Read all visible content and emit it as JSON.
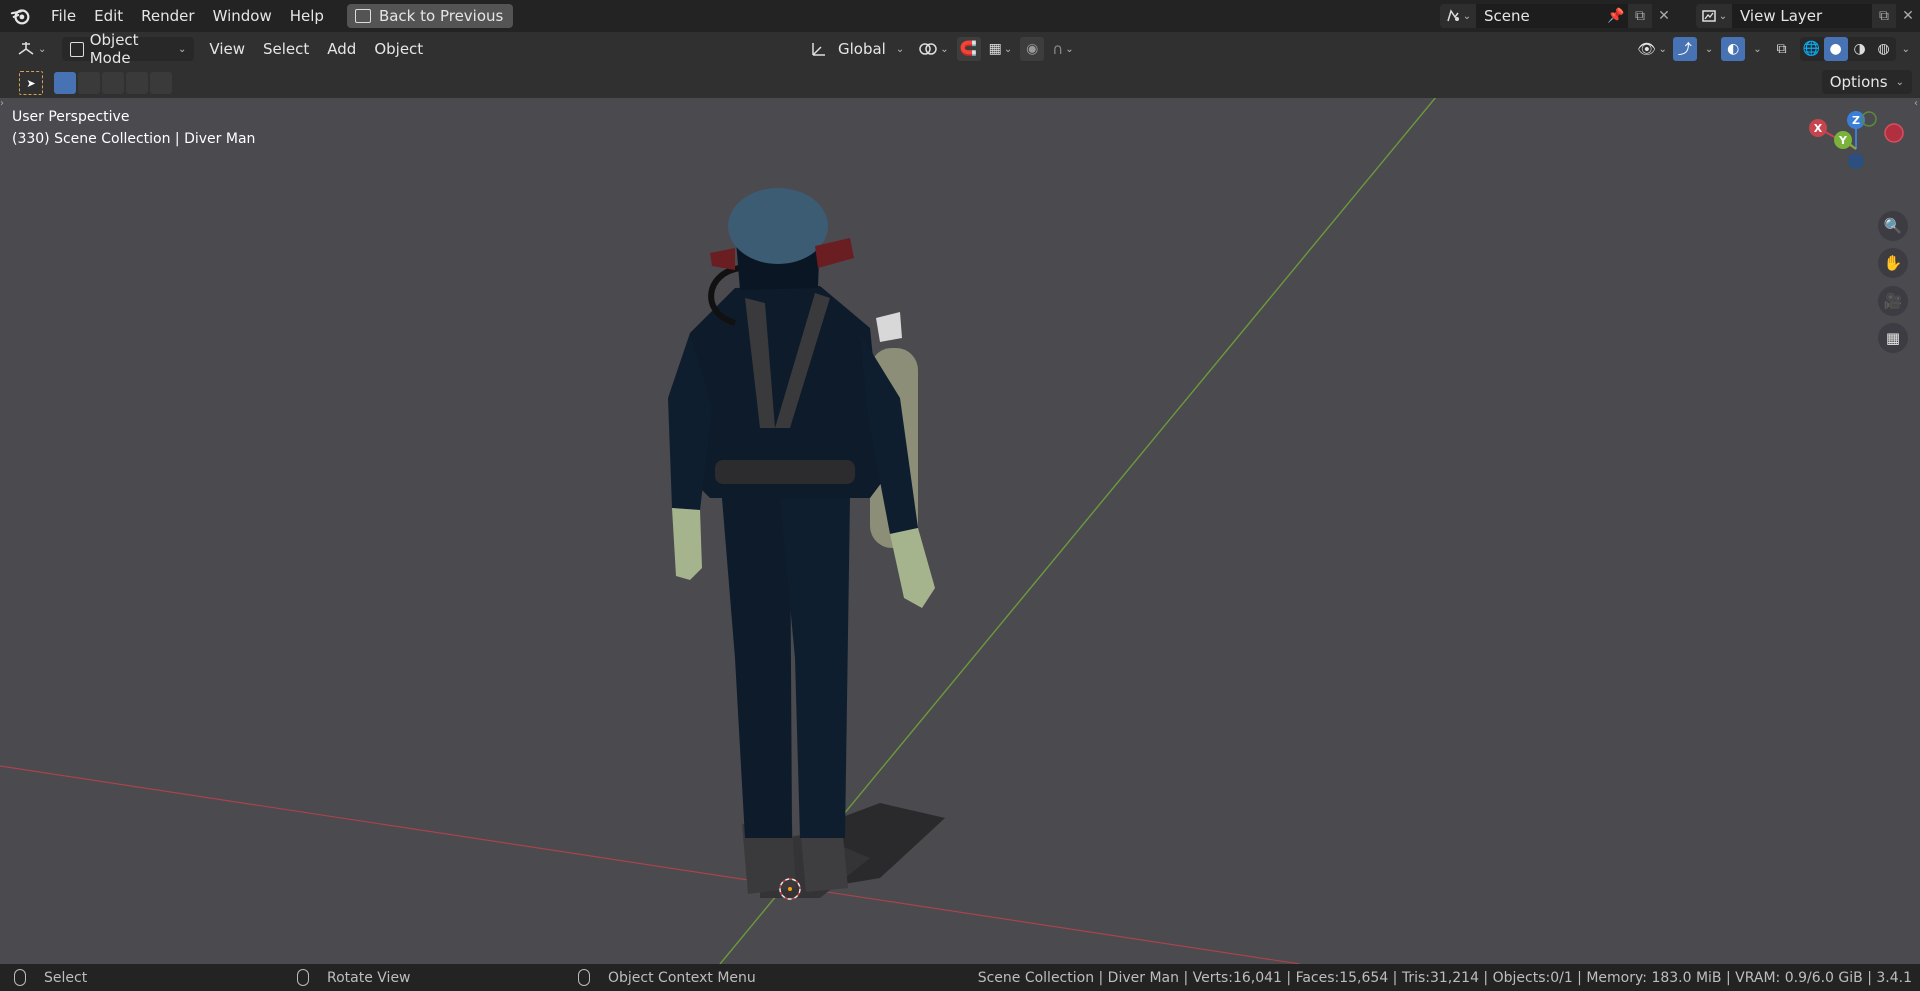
{
  "topbar": {
    "menus": [
      "File",
      "Edit",
      "Render",
      "Window",
      "Help"
    ],
    "back_button": "Back to Previous",
    "scene_name": "Scene",
    "view_layer_name": "View Layer"
  },
  "header": {
    "mode": "Object Mode",
    "menus": [
      "View",
      "Select",
      "Add",
      "Object"
    ],
    "transform_orientation": "Global",
    "options_label": "Options"
  },
  "viewport": {
    "perspective": "User Perspective",
    "collection_info": "(330) Scene Collection | Diver Man",
    "gizmo": {
      "x": "X",
      "y": "Y",
      "z": "Z"
    }
  },
  "statusbar": {
    "left_action": "Select",
    "middle_action": "Rotate View",
    "right_action": "Object Context Menu",
    "stats": "Scene Collection | Diver Man  | Verts:16,041 | Faces:15,654 | Tris:31,214 | Objects:0/1 | Memory: 183.0 MiB | VRAM: 0.9/6.0 GiB | 3.4.1"
  },
  "colors": {
    "accent": "#4772b3",
    "x_axis": "#c8444c",
    "y_axis": "#7ab33a",
    "z_axis": "#3b7ed6"
  }
}
